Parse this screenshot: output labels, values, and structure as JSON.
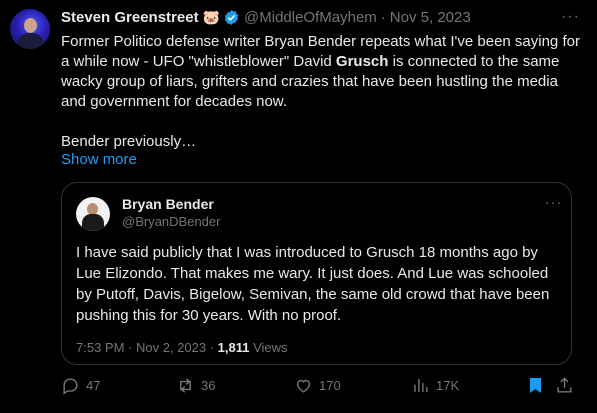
{
  "author": {
    "name": "Steven Greenstreet",
    "emoji": "🐷",
    "handle": "@MiddleOfMayhem",
    "separator": "·",
    "date": "Nov 5, 2023"
  },
  "tweet": {
    "line1_a": "Former Politico defense writer Bryan Bender repeats what I've been saying for a while now - UFO \"whistleblower\" David ",
    "line1_bold": "Grusch",
    "line1_b": " is connected to the same wacky group of liars, grifters and crazies that have been hustling the media and government for decades now.",
    "line2": "Bender previously…",
    "show_more": "Show more"
  },
  "quote": {
    "name": "Bryan Bender",
    "handle": "@BryanDBender",
    "text": "I have said publicly that I was introduced to Grusch 18 months ago by Lue Elizondo. That makes me wary. It just does. And Lue was schooled by Putoff, Davis, Bigelow, Semivan, the same old crowd that have been pushing this for 30 years. With no proof.",
    "time": "7:53 PM · Nov 2, 2023 · ",
    "views_count": "1,811",
    "views_label": " Views"
  },
  "actions": {
    "replies": "47",
    "reposts": "36",
    "likes": "170",
    "views": "17K"
  },
  "colors": {
    "background": "#000000",
    "text": "#e7e9ea",
    "secondary": "#71767b",
    "accent": "#1d9bf0",
    "border": "#2f3336"
  },
  "icons": [
    "verified-badge-icon",
    "more-icon",
    "reply-icon",
    "repost-icon",
    "like-icon",
    "views-icon",
    "bookmark-icon",
    "share-icon"
  ]
}
